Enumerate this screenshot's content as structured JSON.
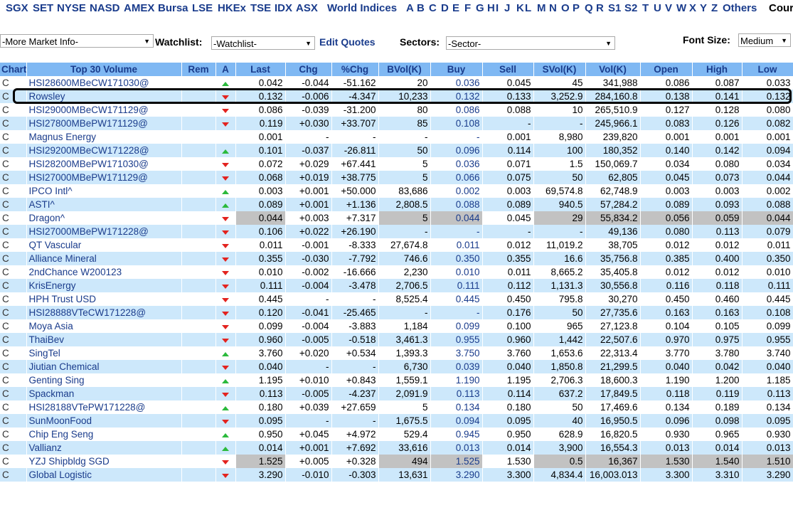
{
  "nav": {
    "exchanges": [
      "SGX",
      "SET",
      "NYSE",
      "NASD",
      "AMEX",
      "Bursa",
      "LSE",
      "HKEx",
      "TSE",
      "IDX",
      "ASX"
    ],
    "world_indices": "World Indices",
    "letters": [
      "A",
      "B",
      "C",
      "D",
      "E",
      "F",
      "G",
      "H",
      "I",
      "J",
      "K",
      "L",
      "M",
      "N",
      "O",
      "P",
      "Q",
      "R",
      "S1",
      "S2",
      "T",
      "U",
      "V",
      "W",
      "X",
      "Y",
      "Z"
    ],
    "others": "Others",
    "counter": "Cour"
  },
  "controls": {
    "market_info": "-More Market Info-",
    "watchlist_label": "Watchlist:",
    "watchlist_value": "-Watchlist-",
    "edit_quotes": "Edit Quotes",
    "sectors_label": "Sectors:",
    "sectors_value": "-Sector-",
    "font_size_label": "Font Size:",
    "font_size_value": "Medium"
  },
  "table": {
    "headers": [
      "Chart",
      "Top 30 Volume",
      "Rem",
      "A",
      "Last",
      "Chg",
      "%Chg",
      "BVol(K)",
      "Buy",
      "Sell",
      "SVol(K)",
      "Vol(K)",
      "Open",
      "High",
      "Low"
    ],
    "rows": [
      {
        "chart": "C",
        "name": "HSI28600MBeCW171030@",
        "dir": "up",
        "last": "0.042",
        "chg": "-0.044",
        "pchg": "-51.162",
        "bvol": "20",
        "buy": "0.036",
        "sell": "0.045",
        "svol": "45",
        "vol": "341,988",
        "open": "0.086",
        "high": "0.087",
        "low": "0.033"
      },
      {
        "chart": "C",
        "name": "Rowsley",
        "dir": "dn",
        "last": "0.132",
        "chg": "-0.006",
        "pchg": "-4.347",
        "bvol": "10,233",
        "buy": "0.132",
        "sell": "0.133",
        "svol": "3,252.9",
        "vol": "284,160.8",
        "open": "0.138",
        "high": "0.141",
        "low": "0.132"
      },
      {
        "chart": "C",
        "name": "HSI29000MBeCW171129@",
        "dir": "dn",
        "last": "0.086",
        "chg": "-0.039",
        "pchg": "-31.200",
        "bvol": "80",
        "buy": "0.086",
        "sell": "0.088",
        "svol": "10",
        "vol": "265,510.9",
        "open": "0.127",
        "high": "0.128",
        "low": "0.080"
      },
      {
        "chart": "C",
        "name": "HSI27800MBePW171129@",
        "dir": "dn",
        "last": "0.119",
        "chg": "+0.030",
        "pchg": "+33.707",
        "bvol": "85",
        "buy": "0.108",
        "sell": "-",
        "svol": "-",
        "vol": "245,966.1",
        "open": "0.083",
        "high": "0.126",
        "low": "0.082"
      },
      {
        "chart": "C",
        "name": "Magnus Energy",
        "dir": "",
        "last": "0.001",
        "chg": "-",
        "pchg": "-",
        "bvol": "-",
        "buy": "-",
        "sell": "0.001",
        "svol": "8,980",
        "vol": "239,820",
        "open": "0.001",
        "high": "0.001",
        "low": "0.001"
      },
      {
        "chart": "C",
        "name": "HSI29200MBeCW171228@",
        "dir": "up",
        "last": "0.101",
        "chg": "-0.037",
        "pchg": "-26.811",
        "bvol": "50",
        "buy": "0.096",
        "sell": "0.114",
        "svol": "100",
        "vol": "180,352",
        "open": "0.140",
        "high": "0.142",
        "low": "0.094"
      },
      {
        "chart": "C",
        "name": "HSI28200MBePW171030@",
        "dir": "dn",
        "last": "0.072",
        "chg": "+0.029",
        "pchg": "+67.441",
        "bvol": "5",
        "buy": "0.036",
        "sell": "0.071",
        "svol": "1.5",
        "vol": "150,069.7",
        "open": "0.034",
        "high": "0.080",
        "low": "0.034"
      },
      {
        "chart": "C",
        "name": "HSI27000MBePW171129@",
        "dir": "dn",
        "last": "0.068",
        "chg": "+0.019",
        "pchg": "+38.775",
        "bvol": "5",
        "buy": "0.066",
        "sell": "0.075",
        "svol": "50",
        "vol": "62,805",
        "open": "0.045",
        "high": "0.073",
        "low": "0.044"
      },
      {
        "chart": "C",
        "name": "IPCO Intl^",
        "dir": "up",
        "last": "0.003",
        "chg": "+0.001",
        "pchg": "+50.000",
        "bvol": "83,686",
        "buy": "0.002",
        "sell": "0.003",
        "svol": "69,574.8",
        "vol": "62,748.9",
        "open": "0.003",
        "high": "0.003",
        "low": "0.002"
      },
      {
        "chart": "C",
        "name": "ASTI^",
        "dir": "up",
        "last": "0.089",
        "chg": "+0.001",
        "pchg": "+1.136",
        "bvol": "2,808.5",
        "buy": "0.088",
        "sell": "0.089",
        "svol": "940.5",
        "vol": "57,284.2",
        "open": "0.089",
        "high": "0.093",
        "low": "0.088"
      },
      {
        "chart": "C",
        "name": "Dragon^",
        "dir": "dn",
        "hl": true,
        "last": "0.044",
        "chg": "+0.003",
        "pchg": "+7.317",
        "bvol": "5",
        "buy": "0.044",
        "sell": "0.045",
        "svol": "29",
        "vol": "55,834.2",
        "open": "0.056",
        "high": "0.059",
        "low": "0.044"
      },
      {
        "chart": "C",
        "name": "HSI27000MBePW171228@",
        "dir": "dn",
        "last": "0.106",
        "chg": "+0.022",
        "pchg": "+26.190",
        "bvol": "-",
        "buy": "-",
        "sell": "-",
        "svol": "-",
        "vol": "49,136",
        "open": "0.080",
        "high": "0.113",
        "low": "0.079"
      },
      {
        "chart": "C",
        "name": "QT Vascular",
        "dir": "dn",
        "last": "0.011",
        "chg": "-0.001",
        "pchg": "-8.333",
        "bvol": "27,674.8",
        "buy": "0.011",
        "sell": "0.012",
        "svol": "11,019.2",
        "vol": "38,705",
        "open": "0.012",
        "high": "0.012",
        "low": "0.011"
      },
      {
        "chart": "C",
        "name": "Alliance Mineral",
        "dir": "dn",
        "last": "0.355",
        "chg": "-0.030",
        "pchg": "-7.792",
        "bvol": "746.6",
        "buy": "0.350",
        "sell": "0.355",
        "svol": "16.6",
        "vol": "35,756.8",
        "open": "0.385",
        "high": "0.400",
        "low": "0.350"
      },
      {
        "chart": "C",
        "name": "2ndChance W200123",
        "dir": "dn",
        "last": "0.010",
        "chg": "-0.002",
        "pchg": "-16.666",
        "bvol": "2,230",
        "buy": "0.010",
        "sell": "0.011",
        "svol": "8,665.2",
        "vol": "35,405.8",
        "open": "0.012",
        "high": "0.012",
        "low": "0.010"
      },
      {
        "chart": "C",
        "name": "KrisEnergy",
        "dir": "dn",
        "last": "0.111",
        "chg": "-0.004",
        "pchg": "-3.478",
        "bvol": "2,706.5",
        "buy": "0.111",
        "sell": "0.112",
        "svol": "1,131.3",
        "vol": "30,556.8",
        "open": "0.116",
        "high": "0.118",
        "low": "0.111"
      },
      {
        "chart": "C",
        "name": "HPH Trust USD",
        "dir": "dn",
        "last": "0.445",
        "chg": "-",
        "pchg": "-",
        "bvol": "8,525.4",
        "buy": "0.445",
        "sell": "0.450",
        "svol": "795.8",
        "vol": "30,270",
        "open": "0.450",
        "high": "0.460",
        "low": "0.445"
      },
      {
        "chart": "C",
        "name": "HSI28888VTeCW171228@",
        "dir": "dn",
        "last": "0.120",
        "chg": "-0.041",
        "pchg": "-25.465",
        "bvol": "-",
        "buy": "-",
        "sell": "0.176",
        "svol": "50",
        "vol": "27,735.6",
        "open": "0.163",
        "high": "0.163",
        "low": "0.108"
      },
      {
        "chart": "C",
        "name": "Moya Asia",
        "dir": "dn",
        "last": "0.099",
        "chg": "-0.004",
        "pchg": "-3.883",
        "bvol": "1,184",
        "buy": "0.099",
        "sell": "0.100",
        "svol": "965",
        "vol": "27,123.8",
        "open": "0.104",
        "high": "0.105",
        "low": "0.099"
      },
      {
        "chart": "C",
        "name": "ThaiBev",
        "dir": "dn",
        "last": "0.960",
        "chg": "-0.005",
        "pchg": "-0.518",
        "bvol": "3,461.3",
        "buy": "0.955",
        "sell": "0.960",
        "svol": "1,442",
        "vol": "22,507.6",
        "open": "0.970",
        "high": "0.975",
        "low": "0.955"
      },
      {
        "chart": "C",
        "name": "SingTel",
        "dir": "up",
        "last": "3.760",
        "chg": "+0.020",
        "pchg": "+0.534",
        "bvol": "1,393.3",
        "buy": "3.750",
        "sell": "3.760",
        "svol": "1,653.6",
        "vol": "22,313.4",
        "open": "3.770",
        "high": "3.780",
        "low": "3.740"
      },
      {
        "chart": "C",
        "name": "Jiutian Chemical",
        "dir": "dn",
        "last": "0.040",
        "chg": "-",
        "pchg": "-",
        "bvol": "6,730",
        "buy": "0.039",
        "sell": "0.040",
        "svol": "1,850.8",
        "vol": "21,299.5",
        "open": "0.040",
        "high": "0.042",
        "low": "0.040"
      },
      {
        "chart": "C",
        "name": "Genting Sing",
        "dir": "up",
        "last": "1.195",
        "chg": "+0.010",
        "pchg": "+0.843",
        "bvol": "1,559.1",
        "buy": "1.190",
        "sell": "1.195",
        "svol": "2,706.3",
        "vol": "18,600.3",
        "open": "1.190",
        "high": "1.200",
        "low": "1.185"
      },
      {
        "chart": "C",
        "name": "Spackman",
        "dir": "dn",
        "last": "0.113",
        "chg": "-0.005",
        "pchg": "-4.237",
        "bvol": "2,091.9",
        "buy": "0.113",
        "sell": "0.114",
        "svol": "637.2",
        "vol": "17,849.5",
        "open": "0.118",
        "high": "0.119",
        "low": "0.113"
      },
      {
        "chart": "C",
        "name": "HSI28188VTePW171228@",
        "dir": "up",
        "last": "0.180",
        "chg": "+0.039",
        "pchg": "+27.659",
        "bvol": "5",
        "buy": "0.134",
        "sell": "0.180",
        "svol": "50",
        "vol": "17,469.6",
        "open": "0.134",
        "high": "0.189",
        "low": "0.134"
      },
      {
        "chart": "C",
        "name": "SunMoonFood",
        "dir": "dn",
        "last": "0.095",
        "chg": "-",
        "pchg": "-",
        "bvol": "1,675.5",
        "buy": "0.094",
        "sell": "0.095",
        "svol": "40",
        "vol": "16,950.5",
        "open": "0.096",
        "high": "0.098",
        "low": "0.095"
      },
      {
        "chart": "C",
        "name": "Chip Eng Seng",
        "dir": "up",
        "last": "0.950",
        "chg": "+0.045",
        "pchg": "+4.972",
        "bvol": "529.4",
        "buy": "0.945",
        "sell": "0.950",
        "svol": "628.9",
        "vol": "16,820.5",
        "open": "0.930",
        "high": "0.965",
        "low": "0.930"
      },
      {
        "chart": "C",
        "name": "Vallianz",
        "dir": "up",
        "last": "0.014",
        "chg": "+0.001",
        "pchg": "+7.692",
        "bvol": "33,616",
        "buy": "0.013",
        "sell": "0.014",
        "svol": "3,900",
        "vol": "16,554.3",
        "open": "0.013",
        "high": "0.014",
        "low": "0.013"
      },
      {
        "chart": "C",
        "name": "YZJ Shipbldg SGD",
        "dir": "dn",
        "hl": true,
        "last": "1.525",
        "chg": "+0.005",
        "pchg": "+0.328",
        "bvol": "494",
        "buy": "1.525",
        "sell": "1.530",
        "svol": "0.5",
        "vol": "16,367",
        "open": "1.530",
        "high": "1.540",
        "low": "1.510"
      },
      {
        "chart": "C",
        "name": "Global Logistic",
        "dir": "dn",
        "last": "3.290",
        "chg": "-0.010",
        "pchg": "-0.303",
        "bvol": "13,631",
        "buy": "3.290",
        "sell": "3.300",
        "svol": "4,834.4",
        "vol": "16,003.013",
        "open": "3.300",
        "high": "3.310",
        "low": "3.290"
      }
    ]
  }
}
